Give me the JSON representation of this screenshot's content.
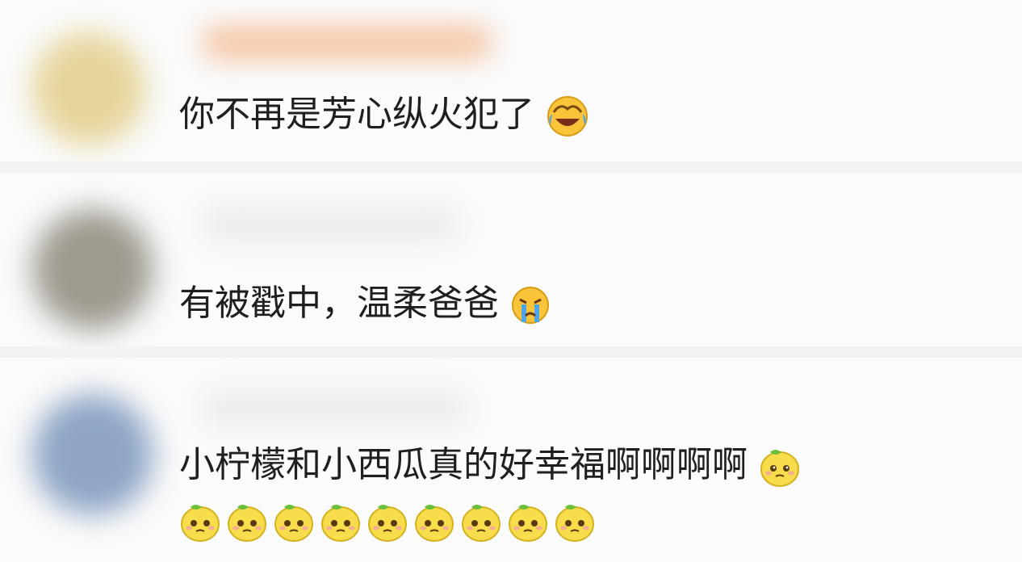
{
  "comments": [
    {
      "text": "你不再是芳心纵火犯了",
      "emoji": "laughing-crying-emoji"
    },
    {
      "text": "有被戳中，温柔爸爸",
      "emoji": "loudly-crying-emoji"
    },
    {
      "text": "小柠檬和小西瓜真的好幸福啊啊啊啊",
      "emoji": "lemon-face-emoji",
      "emoji_repeat_line2": 9
    }
  ],
  "colors": {
    "background": "#fbfbfb",
    "separator": "#f3f3f3",
    "text": "#1f1f1f",
    "avatar1": "#e8d7a0",
    "avatar2": "#9e9a8e",
    "avatar3": "#8fa6c6",
    "name_blur": "#f2c6a8"
  }
}
